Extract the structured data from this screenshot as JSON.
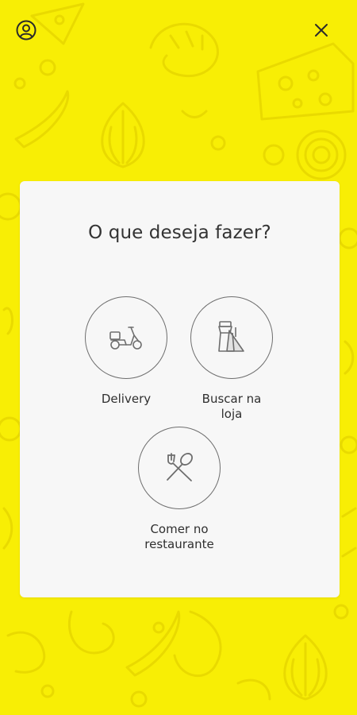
{
  "header": {
    "profile_icon": "user-circle-icon",
    "close_icon": "close-icon"
  },
  "dialog": {
    "title": "O que deseja fazer?",
    "options": [
      {
        "label": "Delivery",
        "icon": "scooter-icon"
      },
      {
        "label": "Buscar na\nloja",
        "icon": "takeaway-bags-icon"
      },
      {
        "label": "Comer no\nrestaurante",
        "icon": "fork-spoon-icon"
      }
    ]
  },
  "colors": {
    "background": "#f8ee05",
    "pattern": "#eadb00",
    "card": "#f7f7f7",
    "text": "#333333",
    "icon_stroke": "#6e6e6e"
  }
}
